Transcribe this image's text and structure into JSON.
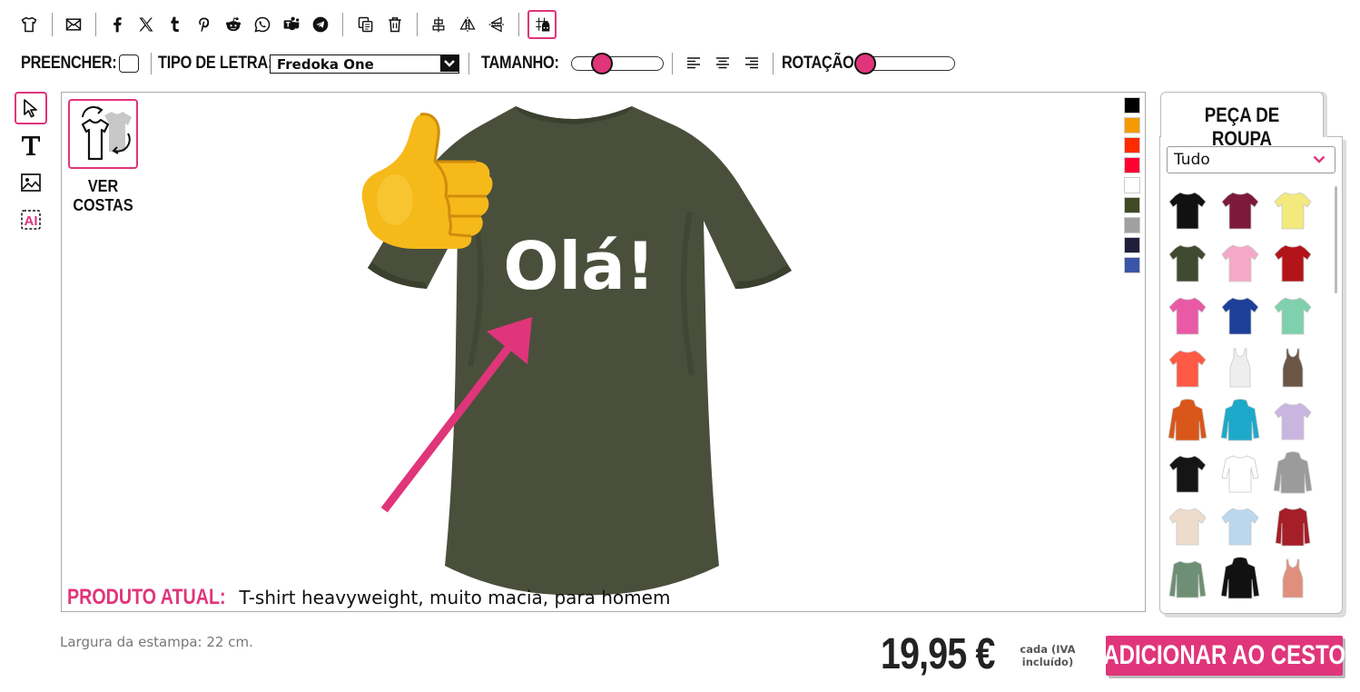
{
  "toolbar": {
    "icons": [
      "tshirt-icon",
      "email-icon",
      "facebook-icon",
      "x-icon",
      "tumblr-icon",
      "pinterest-icon",
      "reddit-icon",
      "whatsapp-icon",
      "teams-icon",
      "telegram-icon",
      "copy-icon",
      "trash-icon",
      "align-center-icon",
      "flip-horizontal-icon",
      "flip-vertical-icon",
      "grid-snap-icon"
    ]
  },
  "format_bar": {
    "fill_label": "PREENCHER:",
    "font_label": "TIPO DE LETRA:",
    "font_value": "Fredoka One",
    "size_label": "TAMANHO:",
    "size_level": 0.28,
    "rotation_label": "ROTAÇÃO:",
    "rotation_level": 0.0
  },
  "tools": [
    "select-tool",
    "text-tool",
    "image-tool",
    "ai-tool"
  ],
  "canvas": {
    "back_label_1": "VER",
    "back_label_2": "COSTAS",
    "design_text": "Olá!",
    "shirt_color": "#4a4f3c",
    "product_label": "PRODUTO ATUAL:",
    "product_name": "T-shirt heavyweight, muito macia, para homem",
    "swatches": [
      "#000000",
      "#f59a00",
      "#ff2a00",
      "#ff0033",
      "#ffffff",
      "#3f4a24",
      "#a0a0a0",
      "#1f1f3d",
      "#3b55a8"
    ]
  },
  "panel": {
    "tab_label": "PEÇA DE ROUPA",
    "category_value": "Tudo",
    "garments": [
      {
        "color": "#111111",
        "type": "tee"
      },
      {
        "color": "#7d1a3b",
        "type": "tee"
      },
      {
        "color": "#f2ea7d",
        "type": "tee"
      },
      {
        "color": "#3f4a30",
        "type": "tee"
      },
      {
        "color": "#f4a9c8",
        "type": "tee"
      },
      {
        "color": "#b3141a",
        "type": "tee"
      },
      {
        "color": "#e85aa5",
        "type": "tee"
      },
      {
        "color": "#1c3f9a",
        "type": "tee"
      },
      {
        "color": "#7fd0ac",
        "type": "tee"
      },
      {
        "color": "#ff5a46",
        "type": "tee"
      },
      {
        "color": "#eeeeee",
        "type": "tank"
      },
      {
        "color": "#6b5646",
        "type": "tank"
      },
      {
        "color": "#d9571a",
        "type": "hoodie"
      },
      {
        "color": "#1da9c9",
        "type": "hoodie"
      },
      {
        "color": "#c9b6e0",
        "type": "tee"
      },
      {
        "color": "#151515",
        "type": "tee"
      },
      {
        "color": "#ffffff",
        "type": "raglan"
      },
      {
        "color": "#9b9b9b",
        "type": "hoodie"
      },
      {
        "color": "#eedccb",
        "type": "tee"
      },
      {
        "color": "#b9d8ef",
        "type": "tee"
      },
      {
        "color": "#a61e28",
        "type": "jacket"
      },
      {
        "color": "#6e8f75",
        "type": "longsleeve"
      },
      {
        "color": "#111111",
        "type": "hoodie"
      },
      {
        "color": "#e08f7c",
        "type": "tank"
      }
    ]
  },
  "footer": {
    "print_width": "Largura da estampa: 22 cm.",
    "price": "19,95 €",
    "vat_line1": "cada (IVA",
    "vat_line2": "incluído)",
    "add_button": "ADICIONAR AO CESTO"
  },
  "colors": {
    "accent": "#e0357a"
  }
}
